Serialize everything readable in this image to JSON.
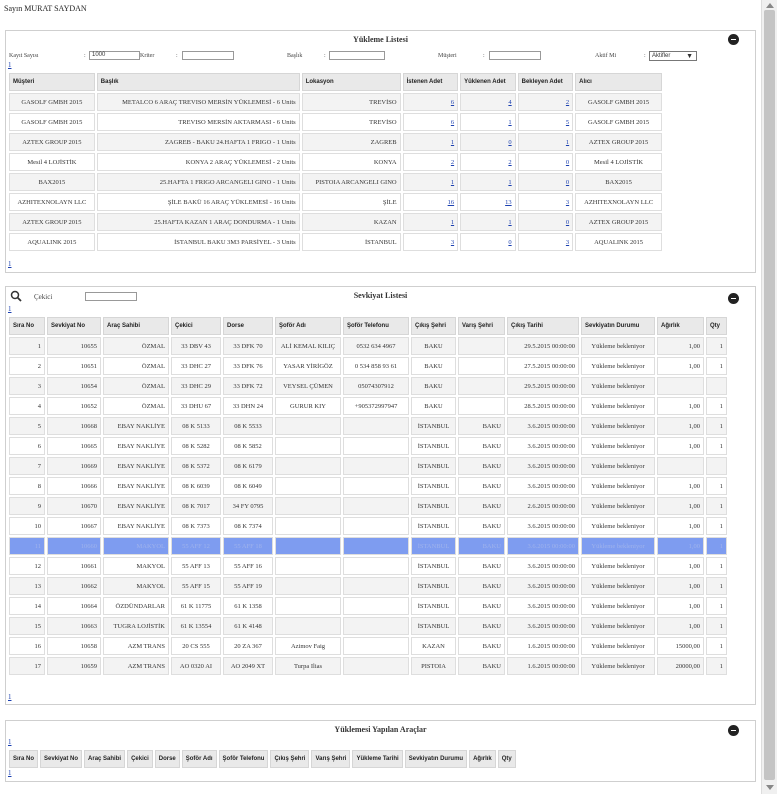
{
  "greeting": "Sayın MURAT SAYDAN",
  "loading_panel": {
    "title": "Yükleme Listesi",
    "filters": {
      "record_count_label": "Kayıt Sayısı",
      "record_count_value": "1000",
      "criteria_label": "Kriter",
      "title_label": "Başlık",
      "customer_label": "Müşteri",
      "active_label": "Aktif Mi",
      "active_value": "Aktifler"
    },
    "pager_top": "1",
    "pager_bottom": "1",
    "columns": [
      "Müşteri",
      "Başlık",
      "Lokasyon",
      "İstenen Adet",
      "Yüklenen Adet",
      "Bekleyen Adet",
      "Alıcı"
    ],
    "rows": [
      {
        "customer": "GASOLF GMBH 2015",
        "title": "METALCO 6 ARAÇ TREVISO MERSİN YÜKLEMESİ - 6 Units",
        "location": "TREVİSO",
        "requested": "6",
        "loaded": "4",
        "pending": "2",
        "receiver": "GASOLF GMBH 2015"
      },
      {
        "customer": "GASOLF GMBH 2015",
        "title": "TREVISO MERSİN AKTARMASI - 6 Units",
        "location": "TREVİSO",
        "requested": "6",
        "loaded": "1",
        "pending": "5",
        "receiver": "GASOLF GMBH 2015"
      },
      {
        "customer": "AZTEX GROUP 2015",
        "title": "ZAGREB - BAKU 24.HAFTA 1 FRIGO - 1 Units",
        "location": "ZAGREB",
        "requested": "1",
        "loaded": "0",
        "pending": "1",
        "receiver": "AZTEX GROUP 2015"
      },
      {
        "customer": "Mesil 4 LOJİSTİK",
        "title": "KONYA 2 ARAÇ YÜKLEMESİ - 2 Units",
        "location": "KONYA",
        "requested": "2",
        "loaded": "2",
        "pending": "0",
        "receiver": "Mesil 4 LOJİSTİK"
      },
      {
        "customer": "BAX2015",
        "title": "25.HAFTA 1 FRIGO ARCANGELI GINO - 1 Units",
        "location": "PISTOIA ARCANGELI GINO",
        "requested": "1",
        "loaded": "1",
        "pending": "0",
        "receiver": "BAX2015"
      },
      {
        "customer": "AZHITEXNOLAYN LLC",
        "title": "ŞİLE BAKÜ 16 ARAÇ YÜKLEMESİ - 16 Units",
        "location": "ŞİLE",
        "requested": "16",
        "loaded": "13",
        "pending": "3",
        "receiver": "AZHITEXNOLAYN LLC"
      },
      {
        "customer": "AZTEX GROUP 2015",
        "title": "25.HAFTA KAZAN 1 ARAÇ DONDURMA - 1 Units",
        "location": "KAZAN",
        "requested": "1",
        "loaded": "1",
        "pending": "0",
        "receiver": "AZTEX GROUP 2015"
      },
      {
        "customer": "AQUALINK 2015",
        "title": "İSTANBUL BAKU 3M3 PARSİYEL - 3 Units",
        "location": "İSTANBUL",
        "requested": "3",
        "loaded": "0",
        "pending": "3",
        "receiver": "AQUALINK 2015"
      }
    ]
  },
  "shipment_panel": {
    "title": "Sevkiyat Listesi",
    "search_label": "Çekici",
    "pager_top": "1",
    "pager_bottom": "1",
    "columns": [
      "Sıra No",
      "Sevkiyat No",
      "Araç Sahibi",
      "Çekici",
      "Dorse",
      "Şoför Adı",
      "Şoför Telefonu",
      "Çıkış Şehri",
      "Varış Şehri",
      "Çıkış Tarihi",
      "Sevkiyatın Durumu",
      "Ağırlık",
      "Qty"
    ],
    "rows": [
      {
        "no": "1",
        "ship": "10655",
        "owner": "ÖZMAL",
        "truck": "33 DBV 43",
        "trailer": "33 DFK 70",
        "driver": "ALİ KEMAL KILIÇ",
        "phone": "0532 634 4967",
        "from": "BAKU",
        "to": "",
        "date": "29.5.2015 00:00:00",
        "status": "Yükleme bekleniyor",
        "weight": "1,00",
        "qty": "1"
      },
      {
        "no": "2",
        "ship": "10651",
        "owner": "ÖZMAL",
        "truck": "33 DHC 27",
        "trailer": "33 DFK 76",
        "driver": "YASAR YİRİGÖZ",
        "phone": "0 534 858 93 61",
        "from": "BAKU",
        "to": "",
        "date": "27.5.2015 00:00:00",
        "status": "Yükleme bekleniyor",
        "weight": "1,00",
        "qty": "1"
      },
      {
        "no": "3",
        "ship": "10654",
        "owner": "ÖZMAL",
        "truck": "33 DHC 29",
        "trailer": "33 DFK 72",
        "driver": "VEYSEL ÇÜMEN",
        "phone": "05074307912",
        "from": "BAKU",
        "to": "",
        "date": "29.5.2015 00:00:00",
        "status": "Yükleme bekleniyor",
        "weight": "",
        "qty": ""
      },
      {
        "no": "4",
        "ship": "10652",
        "owner": "ÖZMAL",
        "truck": "33 DHU 67",
        "trailer": "33 DHN 24",
        "driver": "GURUR KIY",
        "phone": "+905372997947",
        "from": "BAKU",
        "to": "",
        "date": "28.5.2015 00:00:00",
        "status": "Yükleme bekleniyor",
        "weight": "1,00",
        "qty": "1"
      },
      {
        "no": "5",
        "ship": "10668",
        "owner": "EBAY NAKLİYE",
        "truck": "08 K 5133",
        "trailer": "08 K 5533",
        "driver": "",
        "phone": "",
        "from": "İSTANBUL",
        "to": "BAKU",
        "date": "3.6.2015 00:00:00",
        "status": "Yükleme bekleniyor",
        "weight": "1,00",
        "qty": "1"
      },
      {
        "no": "6",
        "ship": "10665",
        "owner": "EBAY NAKLİYE",
        "truck": "08 K 5282",
        "trailer": "08 K 5852",
        "driver": "",
        "phone": "",
        "from": "İSTANBUL",
        "to": "BAKU",
        "date": "3.6.2015 00:00:00",
        "status": "Yükleme bekleniyor",
        "weight": "1,00",
        "qty": "1"
      },
      {
        "no": "7",
        "ship": "10669",
        "owner": "EBAY NAKLİYE",
        "truck": "08 K 5372",
        "trailer": "08 K 6179",
        "driver": "",
        "phone": "",
        "from": "İSTANBUL",
        "to": "BAKU",
        "date": "3.6.2015 00:00:00",
        "status": "Yükleme bekleniyor",
        "weight": "",
        "qty": ""
      },
      {
        "no": "8",
        "ship": "10666",
        "owner": "EBAY NAKLİYE",
        "truck": "08 K 6039",
        "trailer": "08 K 6049",
        "driver": "",
        "phone": "",
        "from": "İSTANBUL",
        "to": "BAKU",
        "date": "3.6.2015 00:00:00",
        "status": "Yükleme bekleniyor",
        "weight": "1,00",
        "qty": "1"
      },
      {
        "no": "9",
        "ship": "10670",
        "owner": "EBAY NAKLİYE",
        "truck": "08 K 7017",
        "trailer": "34 FY 0795",
        "driver": "",
        "phone": "",
        "from": "İSTANBUL",
        "to": "BAKU",
        "date": "2.6.2015 00:00:00",
        "status": "Yükleme bekleniyor",
        "weight": "1,00",
        "qty": "1"
      },
      {
        "no": "10",
        "ship": "10667",
        "owner": "EBAY NAKLİYE",
        "truck": "08 K 7373",
        "trailer": "08 K 7374",
        "driver": "",
        "phone": "",
        "from": "İSTANBUL",
        "to": "BAKU",
        "date": "3.6.2015 00:00:00",
        "status": "Yükleme bekleniyor",
        "weight": "1,00",
        "qty": "1"
      },
      {
        "no": "11",
        "ship": "10660",
        "owner": "MAKYOL",
        "truck": "55 AFF 12",
        "trailer": "55 AFF 18",
        "driver": "",
        "phone": "",
        "from": "İSTANBUL",
        "to": "BAKU",
        "date": "3.6.2015 00:00:00",
        "status": "Yükleme bekleniyor",
        "weight": "1,00",
        "qty": "1"
      },
      {
        "no": "12",
        "ship": "10661",
        "owner": "MAKYOL",
        "truck": "55 AFF 13",
        "trailer": "55 AFF 16",
        "driver": "",
        "phone": "",
        "from": "İSTANBUL",
        "to": "BAKU",
        "date": "3.6.2015 00:00:00",
        "status": "Yükleme bekleniyor",
        "weight": "1,00",
        "qty": "1"
      },
      {
        "no": "13",
        "ship": "10662",
        "owner": "MAKYOL",
        "truck": "55 AFF 15",
        "trailer": "55 AFF 19",
        "driver": "",
        "phone": "",
        "from": "İSTANBUL",
        "to": "BAKU",
        "date": "3.6.2015 00:00:00",
        "status": "Yükleme bekleniyor",
        "weight": "1,00",
        "qty": "1"
      },
      {
        "no": "14",
        "ship": "10664",
        "owner": "ÖZDÜNDARLAR",
        "truck": "61 K 11775",
        "trailer": "61 K 1358",
        "driver": "",
        "phone": "",
        "from": "İSTANBUL",
        "to": "BAKU",
        "date": "3.6.2015 00:00:00",
        "status": "Yükleme bekleniyor",
        "weight": "1,00",
        "qty": "1"
      },
      {
        "no": "15",
        "ship": "10663",
        "owner": "TUGRA LOJİSTİK",
        "truck": "61 K 13554",
        "trailer": "61 K 4148",
        "driver": "",
        "phone": "",
        "from": "İSTANBUL",
        "to": "BAKU",
        "date": "3.6.2015 00:00:00",
        "status": "Yükleme bekleniyor",
        "weight": "1,00",
        "qty": "1"
      },
      {
        "no": "16",
        "ship": "10658",
        "owner": "AZM TRANS",
        "truck": "20 CS 555",
        "trailer": "20 ZA 367",
        "driver": "Azimov Faig",
        "phone": "",
        "from": "KAZAN",
        "to": "BAKU",
        "date": "1.6.2015 00:00:00",
        "status": "Yükleme bekleniyor",
        "weight": "15000,00",
        "qty": "1"
      },
      {
        "no": "17",
        "ship": "10659",
        "owner": "AZM TRANS",
        "truck": "AO 0320 AI",
        "trailer": "AO 2049 XT",
        "driver": "Turpa Ilias",
        "phone": "",
        "from": "PISTOIA",
        "to": "BAKU",
        "date": "1.6.2015 00:00:00",
        "status": "Yükleme bekleniyor",
        "weight": "20000,00",
        "qty": "1"
      }
    ]
  },
  "loaded_panel": {
    "title": "Yüklemesi Yapılan Araçlar",
    "pager_top": "1",
    "pager_bottom": "1",
    "columns": [
      "Sıra No",
      "Sevkiyat No",
      "Araç Sahibi",
      "Çekici",
      "Dorse",
      "Şoför Adı",
      "Şoför Telefonu",
      "Çıkış Şehri",
      "Varış Şehri",
      "Yükleme Tarihi",
      "Sevkiyatın Durumu",
      "Ağırlık",
      "Qty"
    ]
  },
  "colors": {
    "selected_row": "#7e9cf0",
    "link": "#1a3fb0",
    "header_bg": "#e9e9e9"
  }
}
